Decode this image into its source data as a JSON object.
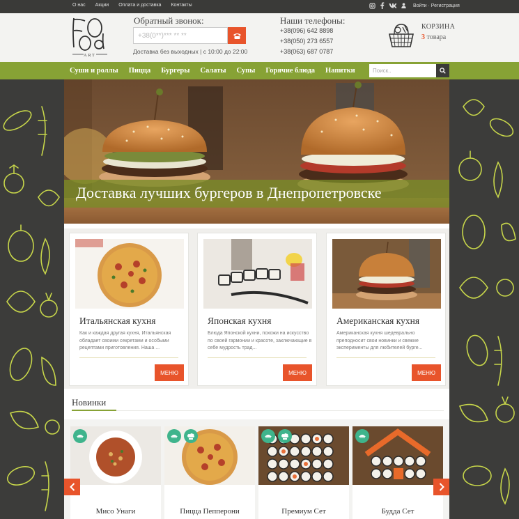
{
  "topbar": {
    "links": [
      "О нас",
      "Акции",
      "Оплата и доставка",
      "Контакты"
    ],
    "social_icons": [
      "instagram-icon",
      "facebook-icon",
      "vk-icon"
    ],
    "auth": "Войти · Регистрация"
  },
  "header": {
    "logo_text": "FOOd",
    "logo_sub": "ART",
    "callback_title": "Обратный звонок:",
    "phone_placeholder": "+38(0**)*** ** **",
    "delivery_hours": "Доставка без выходных | с 10:00 до 22:00",
    "phones_title": "Наши телефоны:",
    "phones": [
      "+38(096) 642 8898",
      "+38(050) 273 6557",
      "+38(063) 687 0787"
    ],
    "cart_title": "КОРЗИНА",
    "cart_count": "3",
    "cart_count_label": "товара"
  },
  "nav": {
    "items": [
      "Суши и роллы",
      "Пицца",
      "Бургеры",
      "Салаты",
      "Супы",
      "Горячие блюда",
      "Напитки"
    ],
    "search_placeholder": "Поиск.."
  },
  "hero": {
    "title": "Доставка лучших бургеров в Днепропетровске"
  },
  "cuisines": [
    {
      "title": "Итальянская кухня",
      "desc": "Как и каждая другая кухня, Итальянская обладает своими секретами и особыми рецептами приготовления. Наша ...",
      "button": "МЕНЮ"
    },
    {
      "title": "Японская кухня",
      "desc": "Блюда Японской кухни, похожи на искусство по своей гармонии и красоте, заключающие в себе мудрость трад...",
      "button": "МЕНЮ"
    },
    {
      "title": "Американская кухня",
      "desc": "Американская кухня шедеврально преподносит свои новинки и свежие эксперименты для любителей бурге...",
      "button": "МЕНЮ"
    }
  ],
  "new_section": {
    "title": "Новинки",
    "products": [
      {
        "name": "Мисо Унаги"
      },
      {
        "name": "Пицца Пепперони"
      },
      {
        "name": "Премиум Сет"
      },
      {
        "name": "Будда Сет"
      }
    ]
  },
  "colors": {
    "accent_orange": "#e8542b",
    "nav_green": "#87a235",
    "badge_green": "#3fb48c",
    "dark_bg": "#3c3c3a"
  }
}
